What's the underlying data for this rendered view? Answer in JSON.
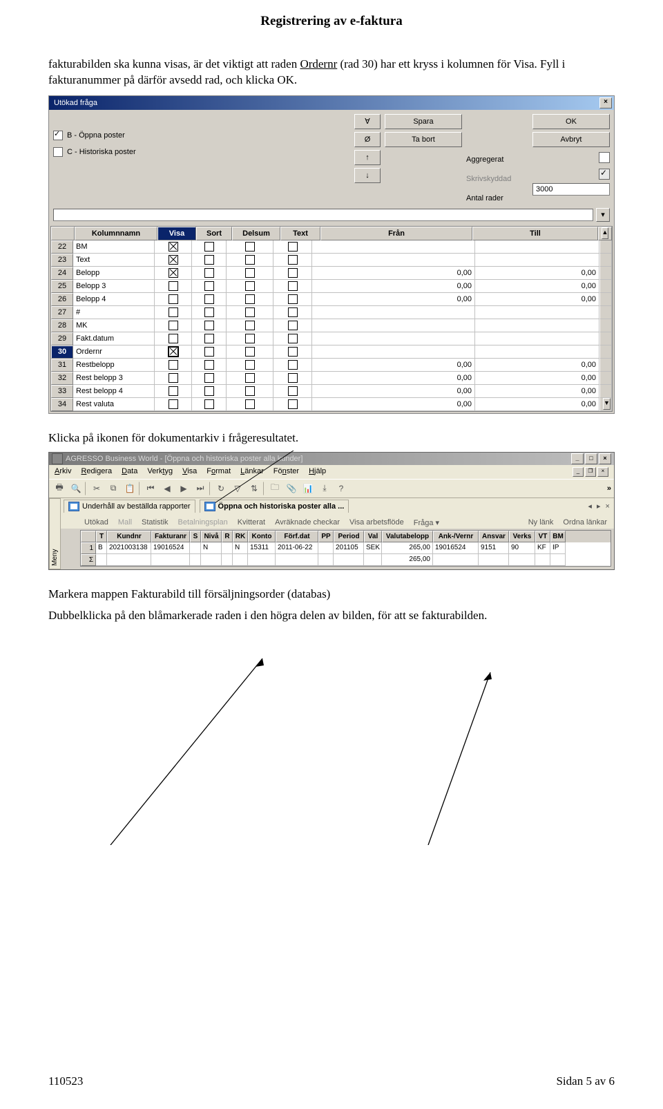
{
  "doc": {
    "title": "Registrering av e-faktura",
    "para1a": "fakturabilden ska kunna visas, är det viktigt att raden ",
    "para1_underlined": "Ordernr",
    "para1b": " (rad 30) har ett kryss i kolumnen för Visa. Fyll i fakturanummer på därför avsedd rad, och klicka OK.",
    "para2": "Klicka på ikonen för dokumentarkiv i frågeresultatet.",
    "para3": "Markera mappen Fakturabild till försäljningsorder (databas)",
    "para4": "Dubbelklicka på den blåmarkerade raden i den högra delen av bilden, för att se fakturabilden.",
    "footer_left": "110523",
    "footer_right": "Sidan 5 av 6"
  },
  "dlg1": {
    "title": "Utökad fråga",
    "close": "×",
    "chk_b": "B - Öppna poster",
    "chk_c": "C - Historiska poster",
    "btn_spara": "Spara",
    "btn_ok": "OK",
    "btn_tabort": "Ta bort",
    "btn_avbryt": "Avbryt",
    "lbl_aggr": "Aggregerat",
    "lbl_skriv": "Skrivskyddad",
    "lbl_antal": "Antal rader",
    "antal_val": "3000",
    "arrows": [
      "∀",
      "Ø",
      "↑",
      "↓"
    ],
    "head": [
      "Kolumnnamn",
      "Visa",
      "Sort",
      "Delsum",
      "Text",
      "Från",
      "Till"
    ],
    "rows": [
      {
        "n": "22",
        "name": "BM",
        "visa": true,
        "fran": "",
        "till": ""
      },
      {
        "n": "23",
        "name": "Text",
        "visa": true,
        "fran": "",
        "till": ""
      },
      {
        "n": "24",
        "name": "Belopp",
        "visa": true,
        "fran": "0,00",
        "till": "0,00"
      },
      {
        "n": "25",
        "name": "Belopp 3",
        "visa": false,
        "fran": "0,00",
        "till": "0,00"
      },
      {
        "n": "26",
        "name": "Belopp 4",
        "visa": false,
        "fran": "0,00",
        "till": "0,00"
      },
      {
        "n": "27",
        "name": "#",
        "visa": false,
        "fran": "",
        "till": ""
      },
      {
        "n": "28",
        "name": "MK",
        "visa": false,
        "fran": "",
        "till": ""
      },
      {
        "n": "29",
        "name": "Fakt.datum",
        "visa": false,
        "fran": "",
        "till": ""
      },
      {
        "n": "30",
        "name": "Ordernr",
        "visa": true,
        "hi": true,
        "fran": "",
        "till": ""
      },
      {
        "n": "31",
        "name": "Restbelopp",
        "visa": false,
        "fran": "0,00",
        "till": "0,00"
      },
      {
        "n": "32",
        "name": "Rest belopp 3",
        "visa": false,
        "fran": "0,00",
        "till": "0,00"
      },
      {
        "n": "33",
        "name": "Rest belopp 4",
        "visa": false,
        "fran": "0,00",
        "till": "0,00"
      },
      {
        "n": "34",
        "name": "Rest valuta",
        "visa": false,
        "fran": "0,00",
        "till": "0,00"
      }
    ]
  },
  "app": {
    "title": "AGRESSO Business World - [Öppna och historiska poster alla kunder]",
    "menus": [
      "Arkiv",
      "Redigera",
      "Data",
      "Verktyg",
      "Visa",
      "Format",
      "Länkar",
      "Fönster",
      "Hjälp"
    ],
    "meny": "Meny",
    "tab1": "Underhåll av beställda rapporter",
    "tab2": "Öppna och historiska poster alla ...",
    "subtabs": [
      "Utökad",
      "Mall",
      "Statistik",
      "Betalningsplan",
      "Kvitterat",
      "Avräknade checkar",
      "Visa arbetsflöde",
      "Fråga ▾"
    ],
    "subtabs_right": [
      "Ny länk",
      "Ordna länkar"
    ],
    "cols": [
      "",
      "T",
      "Kundnr",
      "Fakturanr",
      "S",
      "Nivå",
      "R",
      "RK",
      "Konto",
      "Förf.dat",
      "PP",
      "Period",
      "Val",
      "Valutabelopp",
      "Ank-/Vernr",
      "Ansvar",
      "Verks",
      "VT",
      "BM"
    ],
    "row": [
      "1",
      "B",
      "2021003138",
      "19016524",
      "",
      "N",
      "",
      "N",
      "15311",
      "2011-06-22",
      "",
      "201105",
      "SEK",
      "265,00",
      "19016524",
      "9151",
      "90",
      "KF",
      "IP"
    ],
    "sum_label": "Σ",
    "sum_val": "265,00"
  }
}
